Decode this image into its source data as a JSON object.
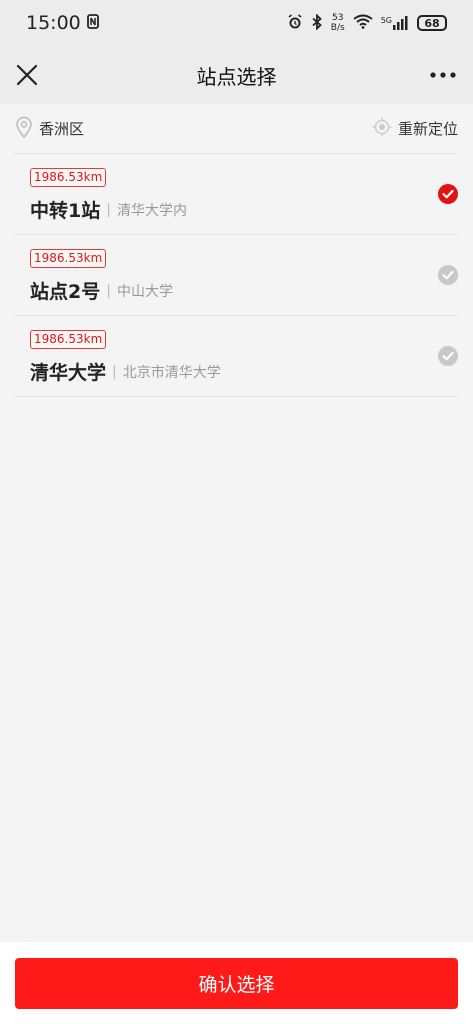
{
  "status": {
    "time": "15:00",
    "net_speed_value": "53",
    "net_speed_unit": "B/s",
    "network": "5G",
    "battery": "68"
  },
  "nav": {
    "title": "站点选择"
  },
  "location": {
    "district": "香洲区",
    "relocate_label": "重新定位"
  },
  "stations": [
    {
      "distance": "1986.53km",
      "name": "中转1站",
      "separator": "|",
      "address": "清华大学内",
      "selected": true
    },
    {
      "distance": "1986.53km",
      "name": "站点2号",
      "separator": "|",
      "address": "中山大学",
      "selected": false
    },
    {
      "distance": "1986.53km",
      "name": "清华大学",
      "separator": "|",
      "address": "北京市清华大学",
      "selected": false
    }
  ],
  "footer": {
    "confirm_label": "确认选择"
  },
  "colors": {
    "accent": "#ff1a1a",
    "selected_check": "#e01414",
    "unselected_check": "#c8c8c8"
  }
}
